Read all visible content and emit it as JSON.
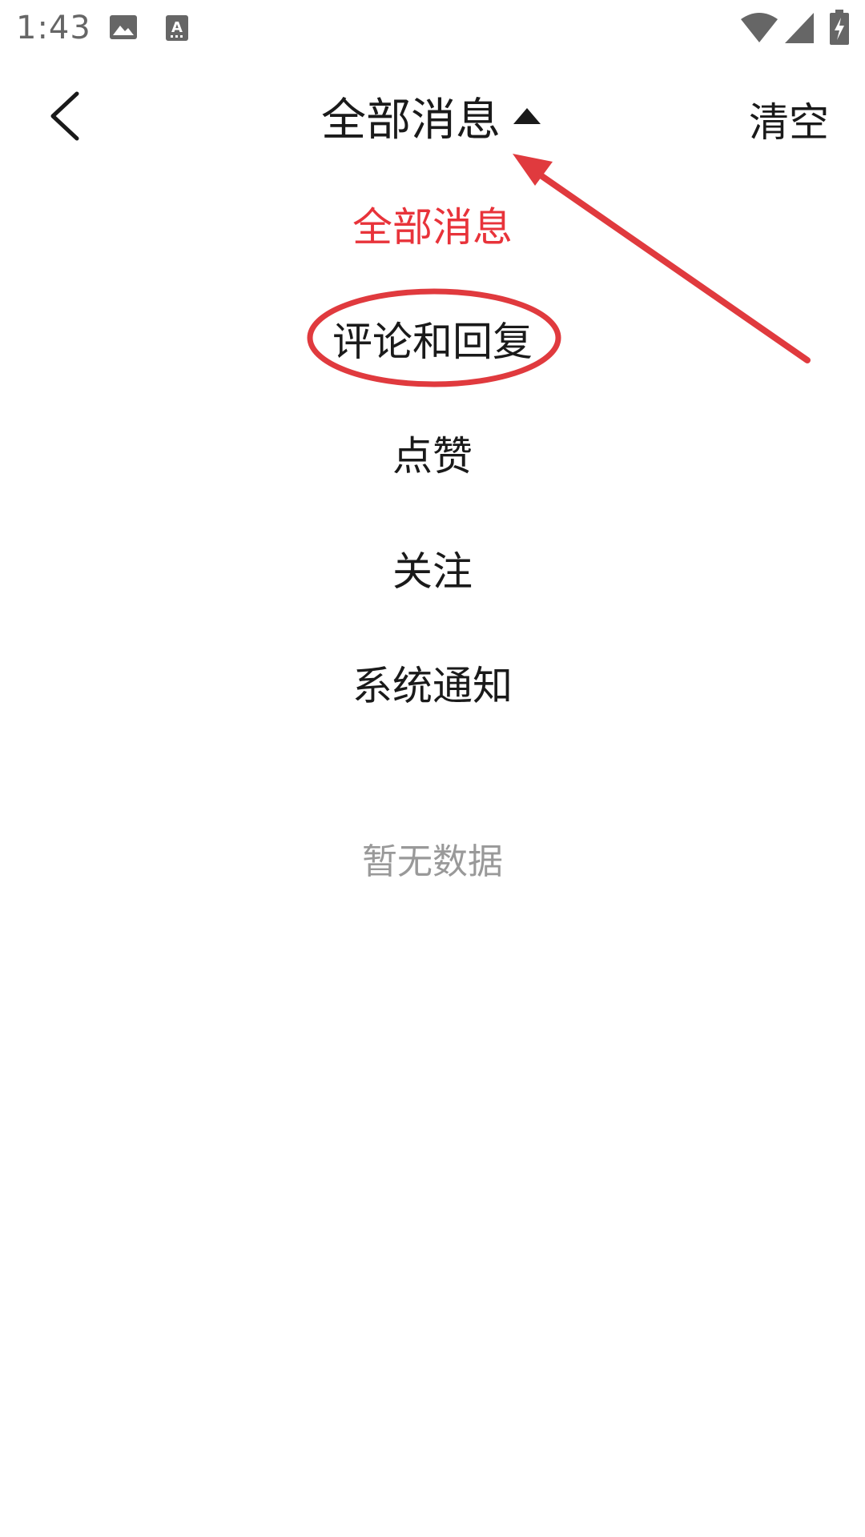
{
  "status_bar": {
    "time": "1:43",
    "icons": [
      "image-icon",
      "text-a-icon",
      "wifi-icon",
      "signal-icon",
      "battery-charging-icon"
    ]
  },
  "header": {
    "title": "全部消息",
    "clear_label": "清空",
    "back_icon": "chevron-left-icon",
    "caret_icon": "caret-up-icon"
  },
  "menu": {
    "items": [
      {
        "label": "全部消息",
        "active": true
      },
      {
        "label": "评论和回复",
        "active": false
      },
      {
        "label": "点赞",
        "active": false
      },
      {
        "label": "关注",
        "active": false
      },
      {
        "label": "系统通知",
        "active": false
      }
    ]
  },
  "empty_state": {
    "text": "暂无数据"
  },
  "colors": {
    "accent": "#e8333a",
    "text": "#1a1a1a",
    "muted": "#999999",
    "annotation": "#e03a3e"
  }
}
